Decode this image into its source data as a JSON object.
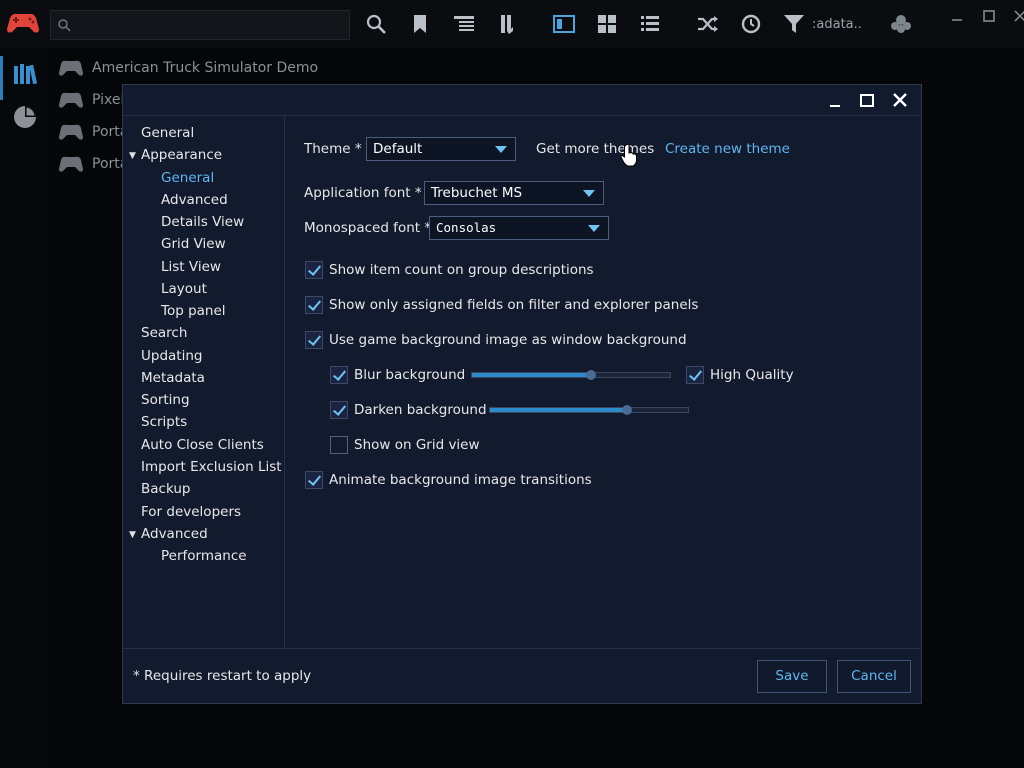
{
  "topbar": {
    "search_placeholder": "",
    "filter_label": ":adata...",
    "icons": [
      "search-icon",
      "bookmark-icon",
      "grouping-icon",
      "sort-icon",
      "details-view-icon",
      "grid-view-icon",
      "list-view-icon",
      "random-icon",
      "clock-icon",
      "filter-icon",
      "achievements-icon"
    ]
  },
  "library": {
    "games": [
      "American Truck Simulator Demo",
      "Pixel",
      "Porta",
      "Porta"
    ]
  },
  "dialog": {
    "nav": {
      "items": [
        {
          "label": "General",
          "level": 0
        },
        {
          "label": "Appearance",
          "level": 0,
          "expanded": true
        },
        {
          "label": "General",
          "level": 1,
          "selected": true
        },
        {
          "label": "Advanced",
          "level": 1
        },
        {
          "label": "Details View",
          "level": 1
        },
        {
          "label": "Grid View",
          "level": 1
        },
        {
          "label": "List View",
          "level": 1
        },
        {
          "label": "Layout",
          "level": 1
        },
        {
          "label": "Top panel",
          "level": 1
        },
        {
          "label": "Search",
          "level": 0
        },
        {
          "label": "Updating",
          "level": 0
        },
        {
          "label": "Metadata",
          "level": 0
        },
        {
          "label": "Sorting",
          "level": 0
        },
        {
          "label": "Scripts",
          "level": 0
        },
        {
          "label": "Auto Close Clients",
          "level": 0
        },
        {
          "label": "Import Exclusion List",
          "level": 0
        },
        {
          "label": "Backup",
          "level": 0
        },
        {
          "label": "For developers",
          "level": 0
        },
        {
          "label": "Advanced",
          "level": 0,
          "expanded": true
        },
        {
          "label": "Performance",
          "level": 1
        }
      ]
    },
    "theme": {
      "label": "Theme *",
      "value": "Default",
      "get_more": "Get more themes",
      "create_new": "Create new theme"
    },
    "app_font": {
      "label": "Application font *",
      "value": "Trebuchet MS"
    },
    "mono_font": {
      "label": "Monospaced font *",
      "value": "Consolas"
    },
    "options": {
      "show_item_count": {
        "label": "Show item count on group descriptions",
        "checked": true
      },
      "show_assigned_fields": {
        "label": "Show only assigned fields on filter and explorer panels",
        "checked": true
      },
      "use_bg_image": {
        "label": "Use game background image as window background",
        "checked": true
      },
      "blur_bg": {
        "label": "Blur background",
        "checked": true,
        "level": 0.6
      },
      "high_quality": {
        "label": "High Quality",
        "checked": true
      },
      "darken_bg": {
        "label": "Darken background",
        "checked": true,
        "level": 0.69
      },
      "show_on_grid": {
        "label": "Show on Grid view",
        "checked": false
      },
      "animate_transitions": {
        "label": "Animate background image transitions",
        "checked": true
      }
    },
    "footer": {
      "note": "* Requires restart to apply",
      "save": "Save",
      "cancel": "Cancel"
    }
  },
  "colors": {
    "accent": "#5fb6f0",
    "dialog_bg": "#121a2e",
    "app_bg": "#050608"
  }
}
